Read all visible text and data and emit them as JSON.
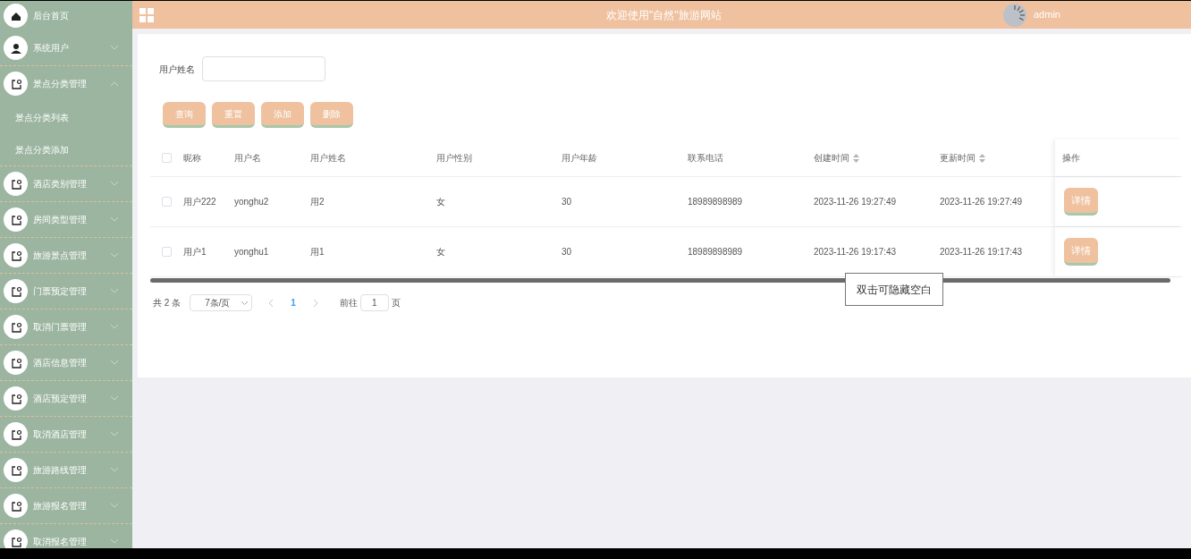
{
  "sidebar": {
    "items": [
      {
        "label": "后台首页",
        "kind": "link"
      },
      {
        "label": "系统用户",
        "kind": "menu",
        "expanded": false
      },
      {
        "label": "景点分类管理",
        "kind": "menu",
        "expanded": true,
        "children": [
          {
            "label": "景点分类列表"
          },
          {
            "label": "景点分类添加"
          }
        ]
      },
      {
        "label": "酒店类别管理",
        "kind": "menu",
        "expanded": false
      },
      {
        "label": "房间类型管理",
        "kind": "menu",
        "expanded": false
      },
      {
        "label": "旅游景点管理",
        "kind": "menu",
        "expanded": false
      },
      {
        "label": "门票预定管理",
        "kind": "menu",
        "expanded": false
      },
      {
        "label": "取消门票管理",
        "kind": "menu",
        "expanded": false
      },
      {
        "label": "酒店信息管理",
        "kind": "menu",
        "expanded": false
      },
      {
        "label": "酒店预定管理",
        "kind": "menu",
        "expanded": false
      },
      {
        "label": "取消酒店管理",
        "kind": "menu",
        "expanded": false
      },
      {
        "label": "旅游路线管理",
        "kind": "menu",
        "expanded": false
      },
      {
        "label": "旅游报名管理",
        "kind": "menu",
        "expanded": false
      },
      {
        "label": "取消报名管理",
        "kind": "menu",
        "expanded": false
      }
    ]
  },
  "header": {
    "title": "欢迎使用\"自然\"旅游网站",
    "user": "admin"
  },
  "search": {
    "label": "用户姓名"
  },
  "buttons": [
    "查询",
    "重置",
    "添加",
    "删除"
  ],
  "table": {
    "select_all_checked": false,
    "columns": [
      {
        "label": "昵称",
        "sortable": false
      },
      {
        "label": "用户名",
        "sortable": false
      },
      {
        "label": "用户姓名",
        "sortable": false
      },
      {
        "label": "用户性别",
        "sortable": false
      },
      {
        "label": "用户年龄",
        "sortable": false
      },
      {
        "label": "联系电话",
        "sortable": false
      },
      {
        "label": "创建时间",
        "sortable": true
      },
      {
        "label": "更新时间",
        "sortable": true
      },
      {
        "label": "操作",
        "sortable": false
      }
    ],
    "rows": [
      {
        "checked": false,
        "cells": [
          "用户222",
          "yonghu2",
          "用2",
          "女",
          "30",
          "18989898989",
          "2023-11-26 19:27:49",
          "2023-11-26 19:27:49"
        ],
        "action": "详情"
      },
      {
        "checked": false,
        "cells": [
          "用户1",
          "yonghu1",
          "用1",
          "女",
          "30",
          "18989898989",
          "2023-11-26 19:17:43",
          "2023-11-26 19:17:43"
        ],
        "action": "详情"
      }
    ]
  },
  "pagination": {
    "total": "共 2 条",
    "page_size": "7条/页",
    "pages": [
      {
        "label": "1",
        "selected": true
      }
    ],
    "goto_label": "前往",
    "goto_value": "1",
    "goto_suffix": "页"
  },
  "tooltip": "双击可隐藏空白"
}
